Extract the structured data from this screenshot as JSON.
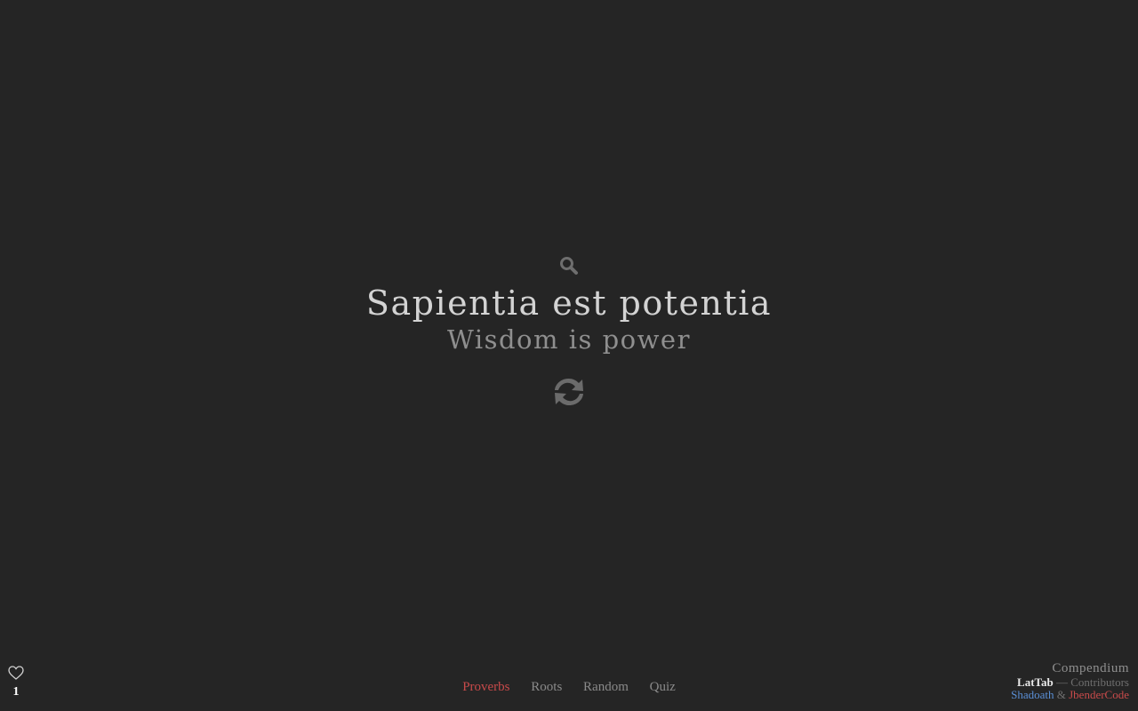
{
  "search": {
    "icon": "search-icon"
  },
  "quote": {
    "latin": "Sapientia est potentia",
    "english": "Wisdom is power"
  },
  "refresh": {
    "icon": "refresh-icon"
  },
  "favorites": {
    "icon": "heart-icon",
    "count": "1"
  },
  "nav": {
    "items": [
      {
        "label": "Proverbs",
        "active": true
      },
      {
        "label": "Roots",
        "active": false
      },
      {
        "label": "Random",
        "active": false
      },
      {
        "label": "Quiz",
        "active": false
      }
    ]
  },
  "footer": {
    "compendium": "Compendium",
    "app_name": "LatTab",
    "separator": " — Contributors",
    "contributor_1": "Shadoath",
    "ampersand": " & ",
    "contributor_2": "JbenderCode"
  },
  "colors": {
    "background": "#252525",
    "accent_red": "#c84a4a",
    "accent_blue": "#5a8fd6"
  }
}
